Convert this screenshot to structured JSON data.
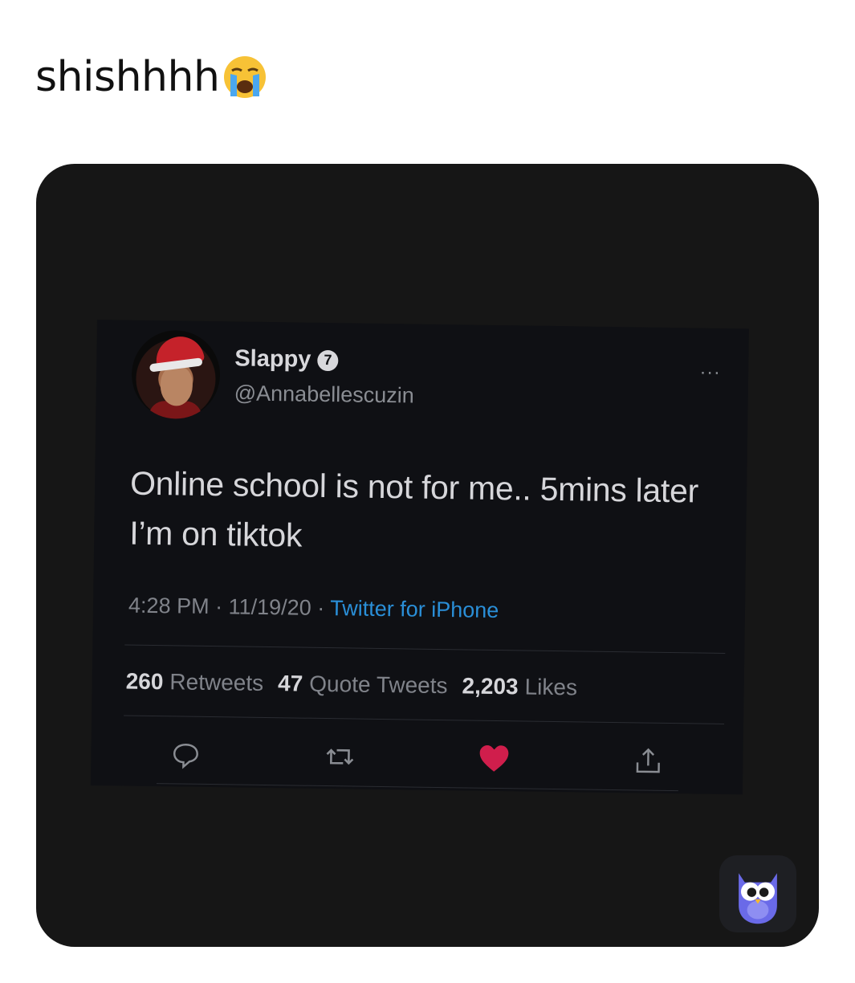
{
  "caption": {
    "text": "shishhhh",
    "emoji": "crying-face-emoji"
  },
  "tweet": {
    "display_name": "Slappy",
    "verified_badge": "7",
    "handle": "@Annabellescuzin",
    "more": "...",
    "text": "Online school is not for me.. 5mins later I’m on tiktok",
    "time": "4:28 PM",
    "date": "11/19/20",
    "separator": "·",
    "source": "Twitter for iPhone",
    "stats": {
      "retweets_count": "260",
      "retweets_label": "Retweets",
      "quotes_count": "47",
      "quotes_label": "Quote Tweets",
      "likes_count": "2,203",
      "likes_label": "Likes"
    },
    "actions": [
      "reply-icon",
      "retweet-icon",
      "like-icon",
      "share-icon"
    ]
  },
  "app_badge": {
    "icon": "owl-icon"
  },
  "colors": {
    "card_bg": "#161616",
    "tweet_bg": "#0f1014",
    "link": "#2a8fd8",
    "like": "#d01e4c",
    "owl": "#6a6ae8"
  }
}
